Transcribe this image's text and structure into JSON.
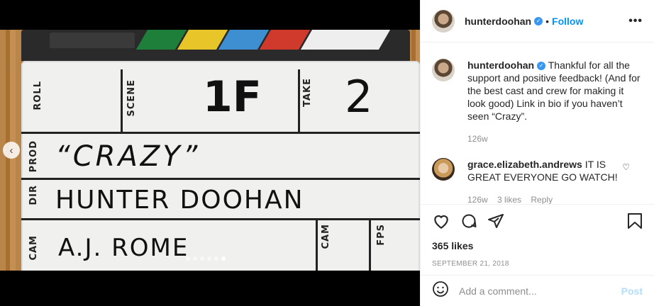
{
  "post": {
    "username": "hunterdoohan",
    "follow_label": "Follow",
    "separator": "•",
    "more": "•••",
    "caption": "Thankful for all the support and positive feedback! (And for the best cast and crew for making it look good) Link in bio if you haven’t seen “Crazy”.",
    "caption_time": "126w",
    "likes": "365 likes",
    "date": "September 21, 2018",
    "comment_placeholder": "Add a comment...",
    "post_label": "Post"
  },
  "comments": [
    {
      "username": "grace.elizabeth.andrews",
      "text": "IT IS GREAT EVERYONE GO WATCH!",
      "time": "126w",
      "likes": "3 likes",
      "reply": "Reply"
    }
  ],
  "slate": {
    "roll_label": "ROLL",
    "scene_label": "SCENE",
    "scene_value": "1F",
    "take_label": "TAKE",
    "take_value": "2",
    "prod_label": "PROD",
    "prod_value": "“CRAZY”",
    "dir_label": "DIR",
    "dir_value": "HUNTER DOOHAN",
    "cam_label": "CAM",
    "cam_value": "A.J. ROME",
    "cam2_label": "CAM",
    "fps_label": "FPS"
  },
  "carousel": {
    "count": 6,
    "active_index": 5
  },
  "colors": {
    "accent": "#0095f6",
    "verified": "#3897f0"
  },
  "icons": [
    "chevron-left-icon",
    "verified-icon",
    "more-icon",
    "heart-icon",
    "comment-icon",
    "share-icon",
    "bookmark-icon",
    "emoji-icon"
  ]
}
